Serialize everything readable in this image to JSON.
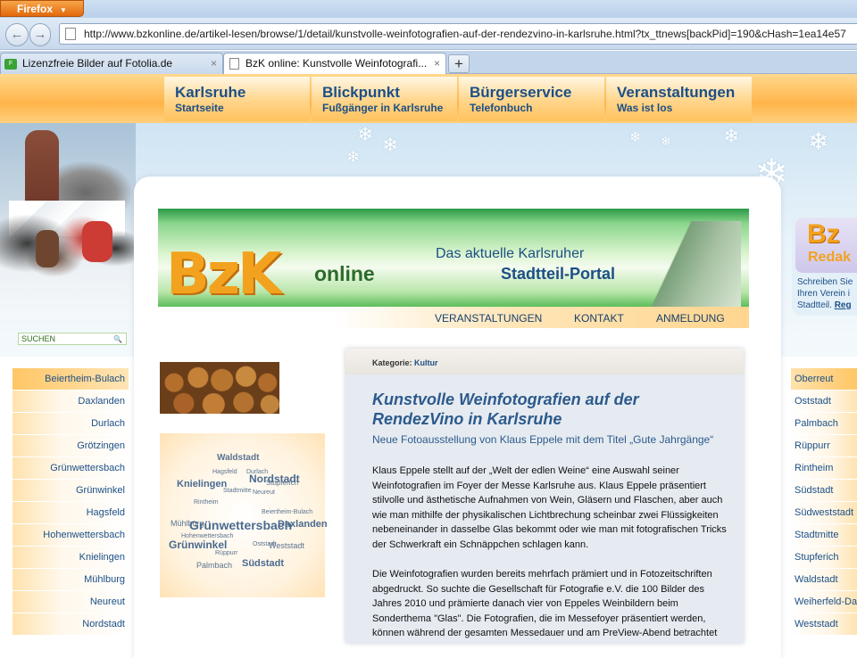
{
  "browser": {
    "firefox_button": "Firefox",
    "url": "http://www.bzkonline.de/artikel-lesen/browse/1/detail/kunstvolle-weinfotografien-auf-der-rendezvino-in-karlsruhe.html?tx_ttnews[backPid]=190&cHash=1ea14e57",
    "tabs": [
      {
        "label": "Lizenzfreie Bilder auf Fotolia.de",
        "close": "×"
      },
      {
        "label": "BzK online: Kunstvolle Weinfotografi...",
        "close": "×"
      }
    ],
    "new_tab": "+"
  },
  "top_nav": [
    {
      "title": "Karlsruhe",
      "subtitle": "Startseite"
    },
    {
      "title": "Blickpunkt",
      "subtitle": "Fußgänger in Karlsruhe"
    },
    {
      "title": "Bürgerservice",
      "subtitle": "Telefonbuch"
    },
    {
      "title": "Veranstaltungen",
      "subtitle": "Was ist los"
    }
  ],
  "search": {
    "label": "SUCHEN"
  },
  "banner": {
    "logo": "BzK",
    "logo_suffix": "online",
    "line1": "Das aktuelle Karlsruher",
    "line2": "Stadtteil-Portal"
  },
  "sub_nav": [
    "VERANSTALTUNGEN",
    "KONTAKT",
    "ANMELDUNG"
  ],
  "left_sidebar": [
    "Beiertheim-Bulach",
    "Daxlanden",
    "Durlach",
    "Grötzingen",
    "Grünwettersbach",
    "Grünwinkel",
    "Hagsfeld",
    "Hohenwettersbach",
    "Knielingen",
    "Mühlburg",
    "Neureut",
    "Nordstadt"
  ],
  "right_sidebar": [
    "Oberreut",
    "Oststadt",
    "Palmbach",
    "Rüppurr",
    "Rintheim",
    "Südstadt",
    "Südweststadt",
    "Stadtmitte",
    "Stupferich",
    "Waldstadt",
    "Weiherfeld-Da",
    "Weststadt"
  ],
  "redaktion": {
    "logo": "Bz",
    "label": "Redak",
    "text_lines": [
      "Schreiben Sie",
      "Ihren Verein i",
      "Stadtteil. "
    ],
    "link": "Reg"
  },
  "tag_cloud": [
    {
      "text": "Waldstadt"
    },
    {
      "text": "Hagsfeld"
    },
    {
      "text": "Durlach"
    },
    {
      "text": "Nordstadt"
    },
    {
      "text": "Knielingen"
    },
    {
      "text": "Stupferich"
    },
    {
      "text": "Grünwinkel"
    },
    {
      "text": "Grünwettersbach"
    },
    {
      "text": "Daxlanden"
    },
    {
      "text": "Weststadt"
    },
    {
      "text": "Südstadt"
    },
    {
      "text": "Palmbach"
    },
    {
      "text": "Rintheim"
    },
    {
      "text": "Beiertheim-Bulach"
    },
    {
      "text": "Hohenwettersbach"
    },
    {
      "text": "Mühlburg"
    },
    {
      "text": "Oststadt"
    },
    {
      "text": "Stadtmitte"
    },
    {
      "text": "Neureut"
    },
    {
      "text": "Rüppurr"
    }
  ],
  "article": {
    "category_label": "Kategorie:",
    "category": "Kultur",
    "title": "Kunstvolle Weinfotografien auf der RendezVino in Karlsruhe",
    "subtitle": "Neue Fotoausstellung von Klaus Eppele mit dem Titel „Gute Jahrgänge“",
    "paragraph1": "Klaus Eppele stellt auf der „Welt der edlen Weine“ eine Auswahl seiner Weinfotografien im Foyer der Messe Karlsruhe aus. Klaus Eppele präsentiert stilvolle und ästhetische Aufnahmen von Wein, Gläsern und Flaschen, aber auch wie man mithilfe der physikalischen Lichtbrechung scheinbar zwei Flüssigkeiten nebeneinander in dasselbe Glas bekommt oder wie man mit fotografischen Tricks der Schwerkraft ein Schnäppchen schlagen kann.",
    "paragraph2": "Die Weinfotografien wurden bereits mehrfach prämiert und in Fotozeitschriften abgedruckt. So suchte die Gesellschaft für Fotografie e.V. die 100 Bilder des Jahres 2010 und prämierte danach vier von Eppeles Weinbildern beim Sonderthema \"Glas\". Die Fotografien, die im Messefoyer präsentiert werden, können während der gesamten Messedauer und am PreView-Abend betrachtet"
  }
}
